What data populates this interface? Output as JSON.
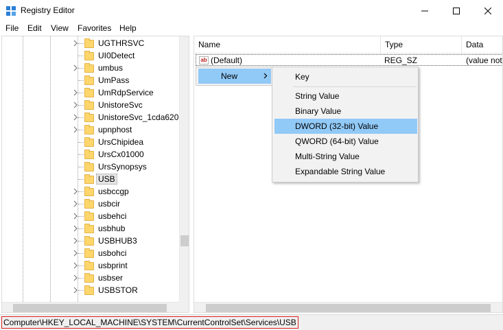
{
  "window": {
    "title": "Registry Editor",
    "minimize_icon": "minimize-icon",
    "maximize_icon": "maximize-icon",
    "close_icon": "close-icon"
  },
  "menubar": {
    "items": [
      "File",
      "Edit",
      "View",
      "Favorites",
      "Help"
    ]
  },
  "tree": {
    "items": [
      {
        "label": "UGTHRSVC",
        "expandable": true
      },
      {
        "label": "UI0Detect",
        "expandable": false
      },
      {
        "label": "umbus",
        "expandable": true
      },
      {
        "label": "UmPass",
        "expandable": false
      },
      {
        "label": "UmRdpService",
        "expandable": true
      },
      {
        "label": "UnistoreSvc",
        "expandable": true
      },
      {
        "label": "UnistoreSvc_1cda620",
        "expandable": true
      },
      {
        "label": "upnphost",
        "expandable": true
      },
      {
        "label": "UrsChipidea",
        "expandable": false
      },
      {
        "label": "UrsCx01000",
        "expandable": false
      },
      {
        "label": "UrsSynopsys",
        "expandable": false
      },
      {
        "label": "USB",
        "expandable": false,
        "selected": true
      },
      {
        "label": "usbccgp",
        "expandable": true
      },
      {
        "label": "usbcir",
        "expandable": true
      },
      {
        "label": "usbehci",
        "expandable": true
      },
      {
        "label": "usbhub",
        "expandable": true
      },
      {
        "label": "USBHUB3",
        "expandable": true
      },
      {
        "label": "usbohci",
        "expandable": true
      },
      {
        "label": "usbprint",
        "expandable": true
      },
      {
        "label": "usbser",
        "expandable": true
      },
      {
        "label": "USBSTOR",
        "expandable": true
      }
    ]
  },
  "list": {
    "columns": [
      "Name",
      "Type",
      "Data"
    ],
    "rows": [
      {
        "name": "(Default)",
        "type": "REG_SZ",
        "data": "(value not"
      }
    ],
    "value_icon": "ab-icon"
  },
  "context_menu": {
    "new_label": "New",
    "arrow": "›"
  },
  "submenu": {
    "items": [
      "Key",
      "String Value",
      "Binary Value",
      "DWORD (32-bit) Value",
      "QWORD (64-bit) Value",
      "Multi-String Value",
      "Expandable String Value"
    ],
    "highlighted": "DWORD (32-bit) Value"
  },
  "statusbar": {
    "path": "Computer\\HKEY_LOCAL_MACHINE\\SYSTEM\\CurrentControlSet\\Services\\USB"
  },
  "colors": {
    "highlight": "#91c9f7",
    "folder": "#ffd66b",
    "path_border": "#e02020"
  }
}
